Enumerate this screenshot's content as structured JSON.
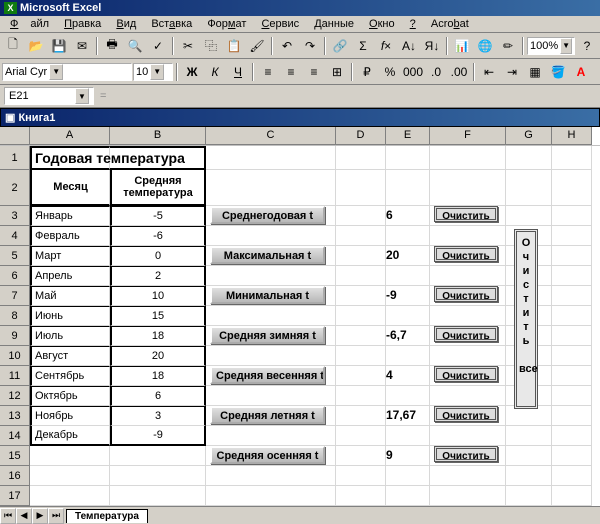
{
  "app": {
    "title": "Microsoft Excel"
  },
  "menu": {
    "file": "Файл",
    "edit": "Правка",
    "view": "Вид",
    "insert": "Вставка",
    "format": "Формат",
    "tools": "Сервис",
    "data": "Данные",
    "window": "Окно",
    "help": "?",
    "acrobat": "Acrobat"
  },
  "toolbar": {
    "font": "Arial Cyr",
    "size": "10",
    "zoom": "100%"
  },
  "namebox": "E21",
  "workbook": "Книга1",
  "columns": [
    "A",
    "B",
    "C",
    "D",
    "E",
    "F",
    "G",
    "H"
  ],
  "table": {
    "title": "Годовая температура",
    "h1": "Месяц",
    "h2": "Средняя температура",
    "rows": [
      {
        "m": "Январь",
        "t": "-5"
      },
      {
        "m": "Февраль",
        "t": "-6"
      },
      {
        "m": "Март",
        "t": "0"
      },
      {
        "m": "Апрель",
        "t": "2"
      },
      {
        "m": "Май",
        "t": "10"
      },
      {
        "m": "Июнь",
        "t": "15"
      },
      {
        "m": "Июль",
        "t": "18"
      },
      {
        "m": "Август",
        "t": "20"
      },
      {
        "m": "Сентябрь",
        "t": "18"
      },
      {
        "m": "Октябрь",
        "t": "6"
      },
      {
        "m": "Ноябрь",
        "t": "3"
      },
      {
        "m": "Декабрь",
        "t": "-9"
      }
    ]
  },
  "buttons": [
    {
      "label": "Среднегодовая t",
      "val": "6"
    },
    {
      "label": "Максимальная  t",
      "val": "20"
    },
    {
      "label": "Минимальная   t",
      "val": "-9"
    },
    {
      "label": "Средняя зимняя t",
      "val": "-6,7"
    },
    {
      "label": "Средняя весенняя t",
      "val": "4"
    },
    {
      "label": "Средняя летняя t",
      "val": "17,67"
    },
    {
      "label": "Средняя осенняя t",
      "val": "9"
    }
  ],
  "clear": "Очистить",
  "clear_all": "О ч и с т и т ь   все",
  "sheet_tab": "Температура",
  "chart_data": {
    "type": "table",
    "title": "Годовая температура",
    "columns": [
      "Месяц",
      "Средняя температура"
    ],
    "rows": [
      [
        "Январь",
        -5
      ],
      [
        "Февраль",
        -6
      ],
      [
        "Март",
        0
      ],
      [
        "Апрель",
        2
      ],
      [
        "Май",
        10
      ],
      [
        "Июнь",
        15
      ],
      [
        "Июль",
        18
      ],
      [
        "Август",
        20
      ],
      [
        "Сентябрь",
        18
      ],
      [
        "Октябрь",
        6
      ],
      [
        "Ноябрь",
        3
      ],
      [
        "Декабрь",
        -9
      ]
    ],
    "stats": {
      "Среднегодовая t": 6,
      "Максимальная t": 20,
      "Минимальная t": -9,
      "Средняя зимняя t": -6.7,
      "Средняя весенняя t": 4,
      "Средняя летняя t": 17.67,
      "Средняя осенняя t": 9
    }
  }
}
